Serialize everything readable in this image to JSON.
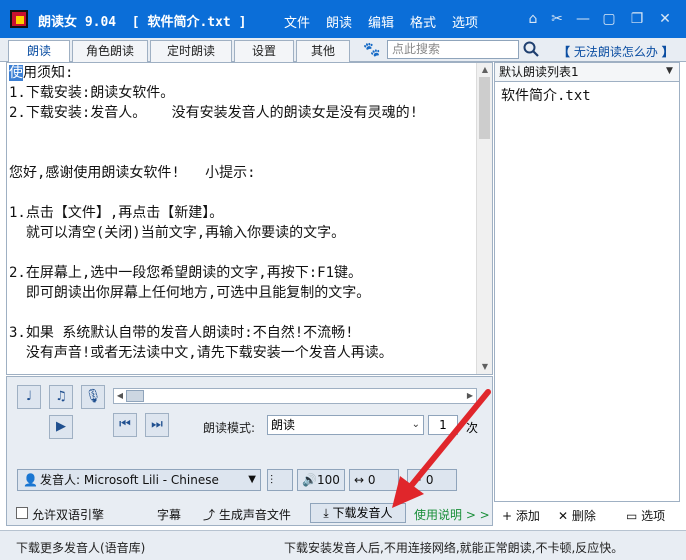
{
  "app": {
    "title": "朗读女 9.04  [ 软件简介.txt ]"
  },
  "menu": [
    "文件",
    "朗读",
    "编辑",
    "格式",
    "选项"
  ],
  "tabs": [
    "朗读",
    "角色朗读",
    "定时朗读",
    "设置",
    "其他"
  ],
  "search": {
    "placeholder": "点此搜索"
  },
  "help_link": "无法朗读怎么办",
  "editor": {
    "first_char": "使",
    "lines": [
      "用须知:",
      "1.下载安装:朗读女软件。",
      "2.下载安装:发音人。   没有安装发音人的朗读女是没有灵魂的!",
      "",
      "",
      "您好,感谢使用朗读女软件!   小提示:",
      "",
      "1.点击【文件】,再点击【新建】。",
      "  就可以清空(关闭)当前文字,再输入你要读的文字。",
      "",
      "2.在屏幕上,选中一段您希望朗读的文字,再按下:F1键。",
      "  即可朗读出你屏幕上任何地方,可选中且能复制的文字。",
      "",
      "3.如果 系统默认自带的发音人朗读时:不自然!不流畅!",
      "  没有声音!或者无法读中文,请先下载安装一个发音人再读。"
    ]
  },
  "playlist": {
    "selected_list": "默认朗读列表1",
    "items": [
      "软件简介.txt"
    ]
  },
  "controls": {
    "mode_label": "朗读模式:",
    "mode_value": "朗读",
    "repeat_count": "1",
    "repeat_unit": "次",
    "voice_label": "发音人: Microsoft Lili - Chinese",
    "volume": "100",
    "rate": "0",
    "pitch": "0"
  },
  "bottom": {
    "bilingual": "允许双语引擎",
    "subtitle": "字幕",
    "generate_audio": "生成声音文件",
    "download_voice": "下载发音人",
    "usage": "使用说明 > >",
    "add": "添加",
    "delete": "删除",
    "options": "选项"
  },
  "status": {
    "left": "下载更多发音人(语音库)",
    "right": "下载安装发音人后,不用连接网络,就能正常朗读,不卡顿,反应快。"
  },
  "colors": {
    "titlebar": "#0b6ed8",
    "accent_blue": "#0b4ea2",
    "usage_green": "#1a8f3a",
    "annotation_red": "#e0262b"
  }
}
